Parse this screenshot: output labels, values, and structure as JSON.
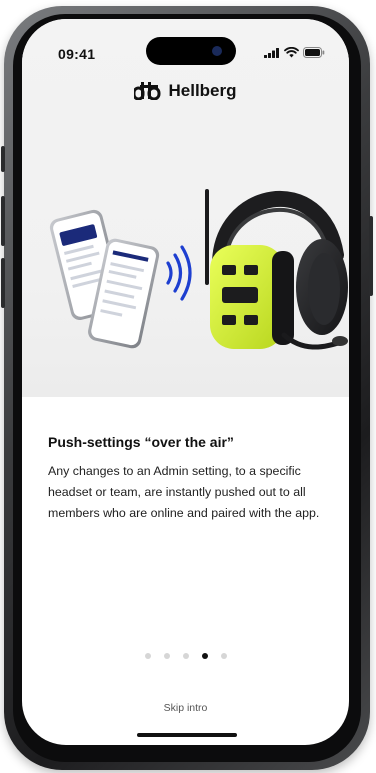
{
  "status_bar": {
    "time": "09:41"
  },
  "brand": {
    "name": "Hellberg",
    "icon": "hellberg-logo-icon"
  },
  "hero": {
    "illustration": "phones-headset-illustration",
    "accent_color": "#d8f23a",
    "signal_color": "#1e3fd0"
  },
  "slide": {
    "title": "Push-settings “over the air”",
    "body": "Any changes to an Admin setting, to a specific headset or team, are instantly pushed out to all members who are online and paired with the app."
  },
  "pagination": {
    "total": 5,
    "current": 4
  },
  "actions": {
    "skip_label": "Skip intro"
  }
}
